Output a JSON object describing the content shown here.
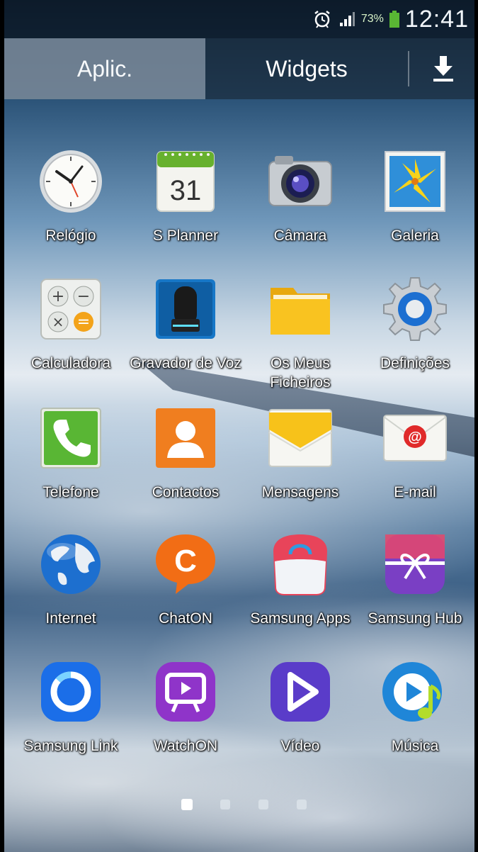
{
  "status_bar": {
    "battery_percent": "73%",
    "time": "12:41",
    "icons": [
      "alarm-icon",
      "signal-icon",
      "battery-icon"
    ]
  },
  "tabs": {
    "apps_label": "Aplic.",
    "widgets_label": "Widgets",
    "download_icon": "download-icon"
  },
  "apps": [
    {
      "label": "Relógio",
      "icon": "clock-icon"
    },
    {
      "label": "S Planner",
      "icon": "calendar-icon",
      "day": "31"
    },
    {
      "label": "Câmara",
      "icon": "camera-icon"
    },
    {
      "label": "Galeria",
      "icon": "gallery-icon"
    },
    {
      "label": "Calculadora",
      "icon": "calculator-icon"
    },
    {
      "label": "Gravador de Voz",
      "icon": "voice-recorder-icon"
    },
    {
      "label": "Os Meus Ficheiros",
      "icon": "folder-icon"
    },
    {
      "label": "Definições",
      "icon": "settings-gear-icon"
    },
    {
      "label": "Telefone",
      "icon": "phone-icon"
    },
    {
      "label": "Contactos",
      "icon": "contacts-icon"
    },
    {
      "label": "Mensagens",
      "icon": "messages-envelope-icon"
    },
    {
      "label": "E-mail",
      "icon": "email-icon"
    },
    {
      "label": "Internet",
      "icon": "globe-icon"
    },
    {
      "label": "ChatON",
      "icon": "chaton-icon",
      "letter": "C"
    },
    {
      "label": "Samsung Apps",
      "icon": "shopping-bag-icon"
    },
    {
      "label": "Samsung Hub",
      "icon": "gift-ribbon-icon"
    },
    {
      "label": "Samsung Link",
      "icon": "samsung-link-icon"
    },
    {
      "label": "WatchON",
      "icon": "tv-icon"
    },
    {
      "label": "Vídeo",
      "icon": "video-play-icon"
    },
    {
      "label": "Música",
      "icon": "music-icon"
    }
  ],
  "pager": {
    "pages": 4,
    "current": 1
  },
  "colors": {
    "accent_green": "#59b634",
    "status_bg": "#0a1622"
  }
}
